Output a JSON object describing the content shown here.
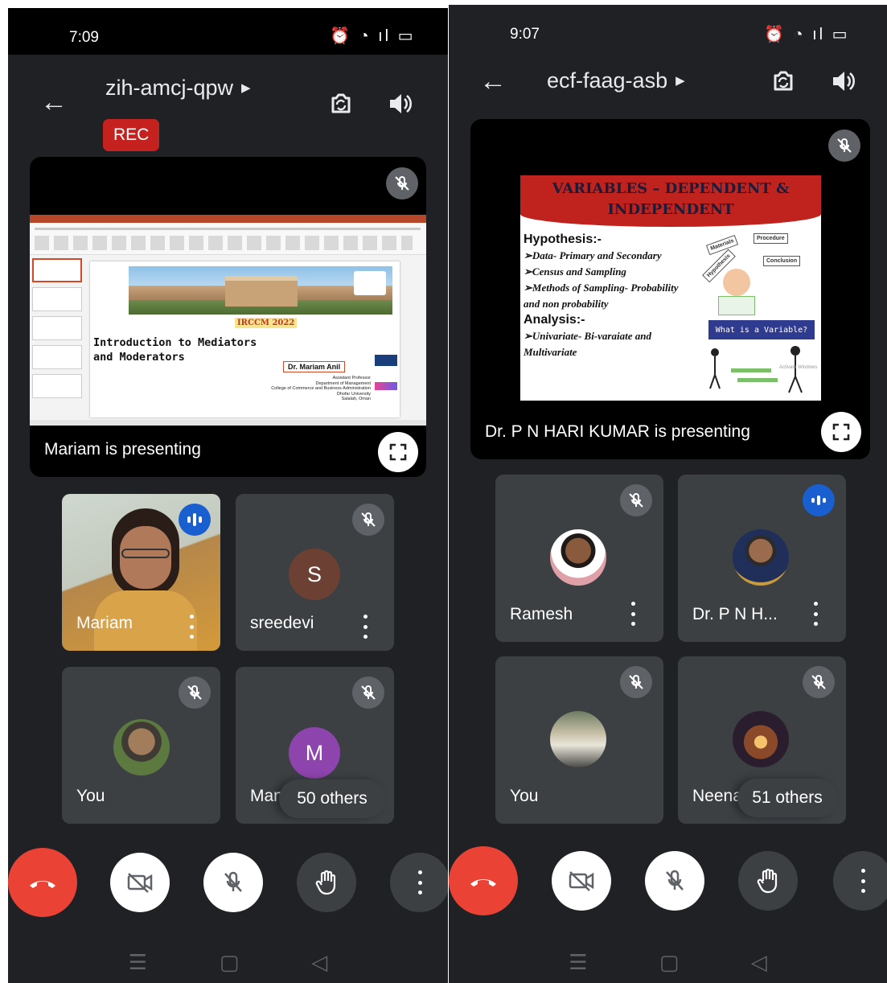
{
  "left": {
    "status_time": "7:09",
    "status_icons": "⏰ ◔ ıl ▭",
    "meeting_code": "zih-amcj-qpw",
    "rec_label": "REC",
    "presenting_label": "Mariam is presenting",
    "slide": {
      "event": "IRCCM 2022",
      "title_line1": "Introduction to Mediators",
      "title_line2": "and Moderators",
      "presenter_name": "Dr. Mariam Anil",
      "affil_line1": "Assistant Professor",
      "affil_line2": "Department of Management",
      "affil_line3": "College of Commerce and Business Administration",
      "affil_line4": "Dhofar University",
      "affil_line5": "Salalah, Oman"
    },
    "tiles": [
      {
        "name": "Mariam"
      },
      {
        "name": "sreedevi",
        "initial": "S"
      },
      {
        "name": "You"
      },
      {
        "name": "Manju",
        "initial": "M"
      }
    ],
    "others_label": "50 others"
  },
  "right": {
    "status_time": "9:07",
    "status_icons": "⏰ ◔ ıl ▭",
    "meeting_code": "ecf-faag-asb",
    "presenting_label": "Dr. P N HARI KUMAR is presenting",
    "slide": {
      "heading_line1": "VARIABLES – DEPENDENT &",
      "heading_line2": "INDEPENDENT",
      "h1": "Hypothesis:-",
      "b1": "➢Data- Primary and Secondary",
      "b2": "➢Census and Sampling",
      "b3": "➢Methods of Sampling- Probability",
      "b3b": "and non probability",
      "h2": "Analysis:-",
      "b4": "➢Univariate- Bi-varaiate and",
      "b4b": "Multivariate",
      "box_label": "What is a Variable?",
      "sign1": "Materials",
      "sign2": "Procedure",
      "sign3": "Conclusion",
      "sign4": "Hypothesis",
      "watermark": "Activate Windows"
    },
    "tiles": [
      {
        "name": "Ramesh"
      },
      {
        "name": "Dr. P N H..."
      },
      {
        "name": "You"
      },
      {
        "name": "Neena"
      }
    ],
    "others_label": "51 others"
  },
  "colors": {
    "background": "#202124",
    "tile": "#3c4043",
    "end_call": "#ea4335",
    "speaking": "#1a5fd0",
    "rec": "#c5221f",
    "avatar_s": "#6d4034",
    "avatar_m": "#8e44ad"
  }
}
